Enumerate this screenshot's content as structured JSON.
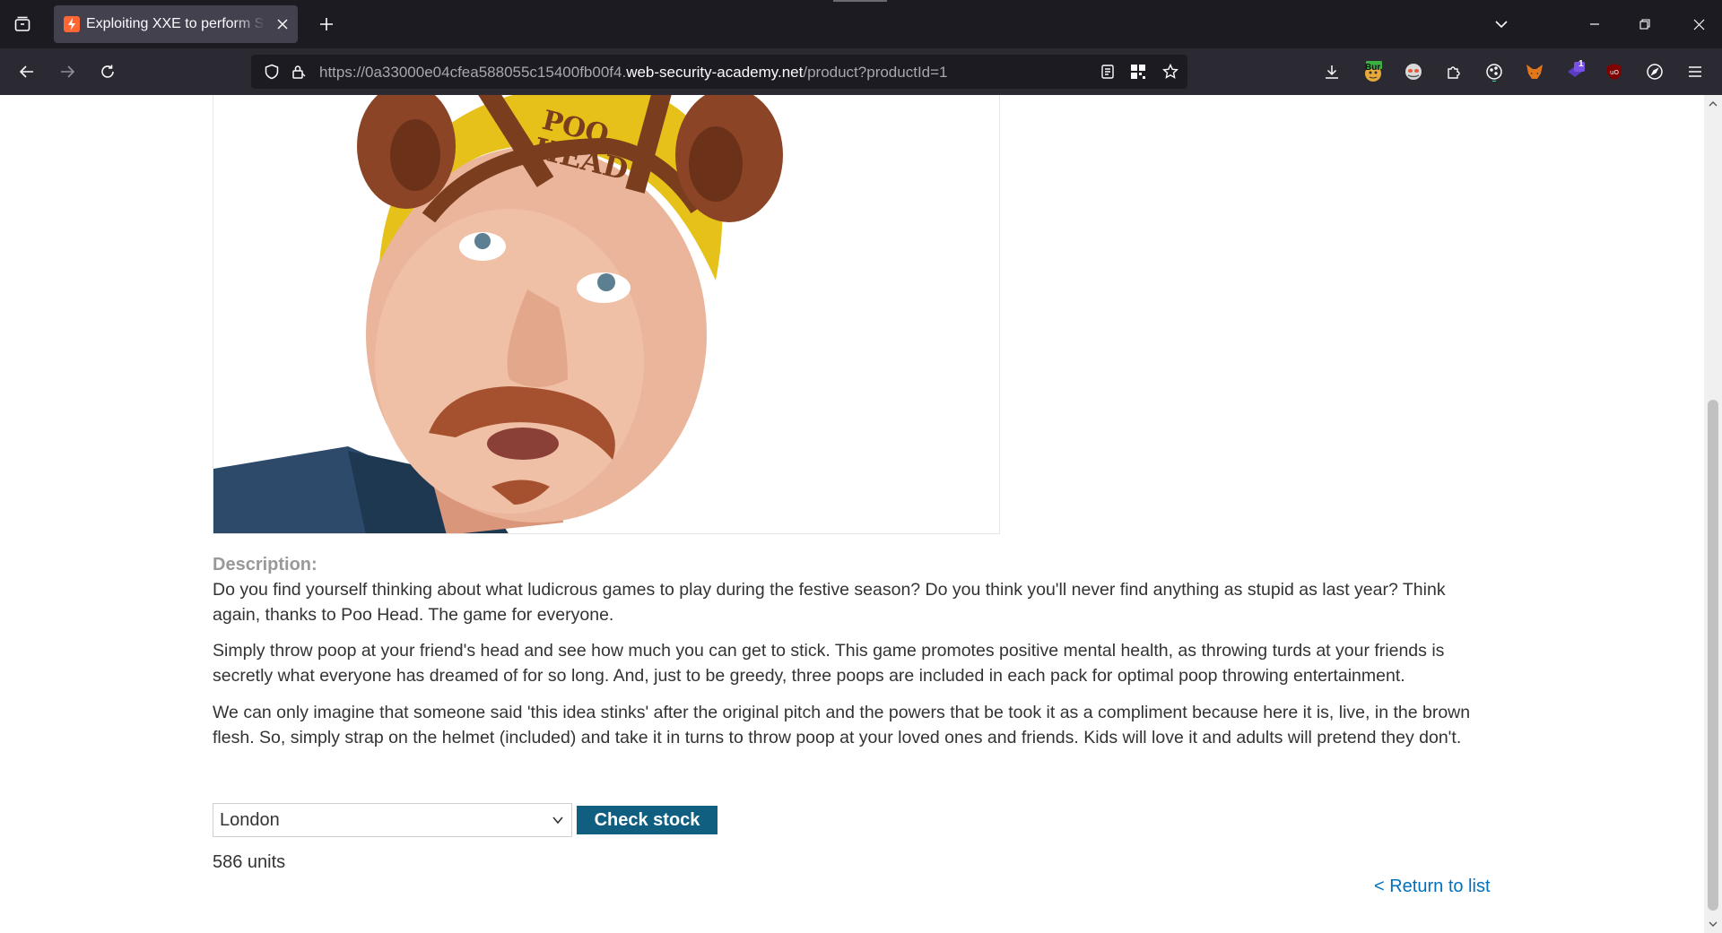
{
  "browser": {
    "tab": {
      "title": "Exploiting XXE to perform SSRF",
      "favicon": "portswigger-lightning-icon"
    },
    "url": {
      "prefix": "https://0a33000e04cfea588055c15400fb00f4.",
      "host": "web-security-academy.net",
      "path": "/product?productId=1"
    },
    "extensions": {
      "burp_badge": "Bur",
      "notification_count": "1"
    },
    "colors": {
      "tabbar_bg": "#1c1b22",
      "navbar_bg": "#2b2a33",
      "active_tab_bg": "#42414d"
    }
  },
  "product": {
    "image_text": {
      "line1": "POO",
      "line2": "HEAD"
    },
    "description_heading": "Description:",
    "paragraphs": [
      "Do you find yourself thinking about what ludicrous games to play during the festive season? Do you think you'll never find anything as stupid as last year? Think again, thanks to Poo Head. The game for everyone.",
      "Simply throw poop at your friend's head and see how much you can get to stick. This game promotes positive mental health, as throwing turds at your friends is secretly what everyone has dreamed of for so long. And, just to be greedy, three poops are included in each pack for optimal poop throwing entertainment.",
      "We can only imagine that someone said 'this idea stinks' after the original pitch and the powers that be took it as a compliment because here it is, live, in the brown flesh. So, simply strap on the helmet (included) and take it in turns to throw poop at your loved ones and friends. Kids will love it and adults will pretend they don't."
    ],
    "stock": {
      "selected_store": "London",
      "check_button": "Check stock",
      "result": "586 units"
    },
    "return_link": "< Return to list"
  },
  "colors": {
    "accent_button": "#105e80",
    "link": "#0071bc",
    "heading_grey": "#999999",
    "body_text": "#333332"
  }
}
